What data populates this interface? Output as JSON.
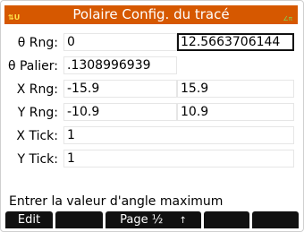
{
  "status": {
    "left_indicator": "⇅U",
    "right_indicator": "∠π"
  },
  "title": "Polaire Config. du tracé",
  "rows": [
    {
      "label": "θ Rng:",
      "value1": "0",
      "value2": "12.5663706144"
    },
    {
      "label": "θ Palier:",
      "value1": ".1308996939"
    },
    {
      "label": "X Rng:",
      "value1": "-15.9",
      "value2": "15.9"
    },
    {
      "label": "Y Rng:",
      "value1": "-10.9",
      "value2": "10.9"
    },
    {
      "label": "X Tick:",
      "value1": "1"
    },
    {
      "label": "Y Tick:",
      "value1": "1"
    }
  ],
  "help_text": "Entrer la valeur d'angle maximum",
  "softkeys": {
    "edit": "Edit",
    "page": "Page ½",
    "page_arrow": "↑"
  },
  "colors": {
    "titlebar": "#d65800",
    "softkey_bg": "#111111"
  }
}
